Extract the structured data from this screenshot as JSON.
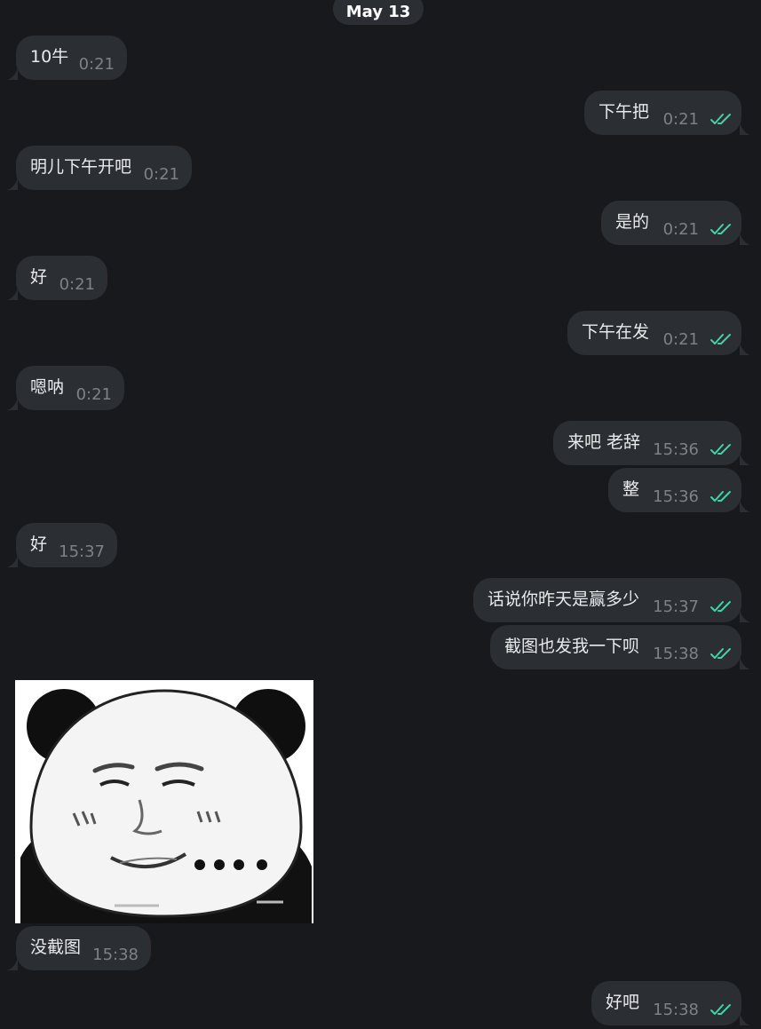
{
  "date_label": "May 13",
  "colors": {
    "background": "#18191d",
    "bubble": "#2b2e33",
    "text": "#e9eaec",
    "time": "#7d8188",
    "read_check": "#3fd4a8"
  },
  "messages": [
    {
      "side": "in",
      "text": "10牛",
      "time": "0:21"
    },
    {
      "side": "out",
      "text": "下午把",
      "time": "0:21",
      "status": "read-double-check-icon"
    },
    {
      "side": "in",
      "text": "明儿下午开吧",
      "time": "0:21"
    },
    {
      "side": "out",
      "text": "是的",
      "time": "0:21",
      "status": "read-double-check-icon"
    },
    {
      "side": "in",
      "text": "好",
      "time": "0:21"
    },
    {
      "side": "out",
      "text": "下午在发",
      "time": "0:21",
      "status": "read-double-check-icon"
    },
    {
      "side": "in",
      "text": "嗯呐",
      "time": "0:21"
    },
    {
      "side": "out",
      "text": "来吧 老辞",
      "time": "15:36",
      "status": "read-double-check-icon"
    },
    {
      "side": "out",
      "text": "整",
      "time": "15:36",
      "status": "read-double-check-icon"
    },
    {
      "side": "in",
      "text": "好",
      "time": "15:37"
    },
    {
      "side": "out",
      "text": "话说你昨天是赢多少",
      "time": "15:37",
      "status": "read-double-check-icon"
    },
    {
      "side": "out",
      "text": "截图也发我一下呗",
      "time": "15:38",
      "status": "read-double-check-icon"
    },
    {
      "side": "in",
      "type": "sticker",
      "sticker": "panda-meme-sticker"
    },
    {
      "side": "in",
      "text": "没截图",
      "time": "15:38"
    },
    {
      "side": "out",
      "text": "好吧",
      "time": "15:38",
      "status": "read-double-check-icon"
    }
  ]
}
